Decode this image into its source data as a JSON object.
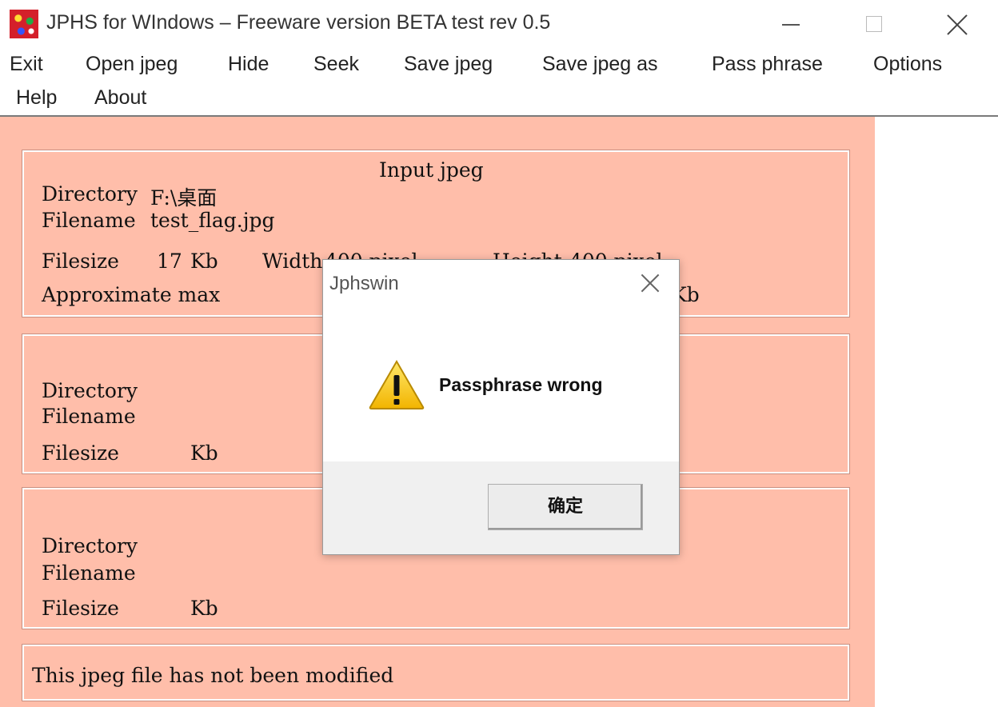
{
  "window": {
    "title": "JPHS for WIndows – Freeware version BETA test rev 0.5"
  },
  "menu": [
    {
      "label": "Exit"
    },
    {
      "label": "Open jpeg"
    },
    {
      "label": "Hide"
    },
    {
      "label": "Seek"
    },
    {
      "label": "Save jpeg"
    },
    {
      "label": "Save jpeg as"
    },
    {
      "label": "Pass phrase"
    },
    {
      "label": "Options"
    },
    {
      "label": "Help"
    },
    {
      "label": "About"
    }
  ],
  "input_panel": {
    "heading": "Input jpeg",
    "directory_label": "Directory",
    "directory_value": "F:\\桌面",
    "filename_label": "Filename",
    "filename_value": "test_flag.jpg",
    "filesize_label": "Filesize",
    "filesize_value": "17",
    "filesize_unit": "Kb",
    "width_label": "Width",
    "width_value": "400 pixel",
    "height_label": "Height",
    "height_value": "400 pixel",
    "approx_label": "Approximate max",
    "approx_unit": "Kb"
  },
  "panel2": {
    "directory_label": "Directory",
    "filename_label": "Filename",
    "filesize_label": "Filesize",
    "filesize_unit": "Kb"
  },
  "panel3": {
    "directory_label": "Directory",
    "filename_label": "Filename",
    "filesize_label": "Filesize",
    "filesize_unit": "Kb"
  },
  "status": {
    "text": "This jpeg file has not been modified"
  },
  "dialog": {
    "title": "Jphswin",
    "message": "Passphrase wrong",
    "ok_label": "确定",
    "icon": "warning-icon"
  }
}
